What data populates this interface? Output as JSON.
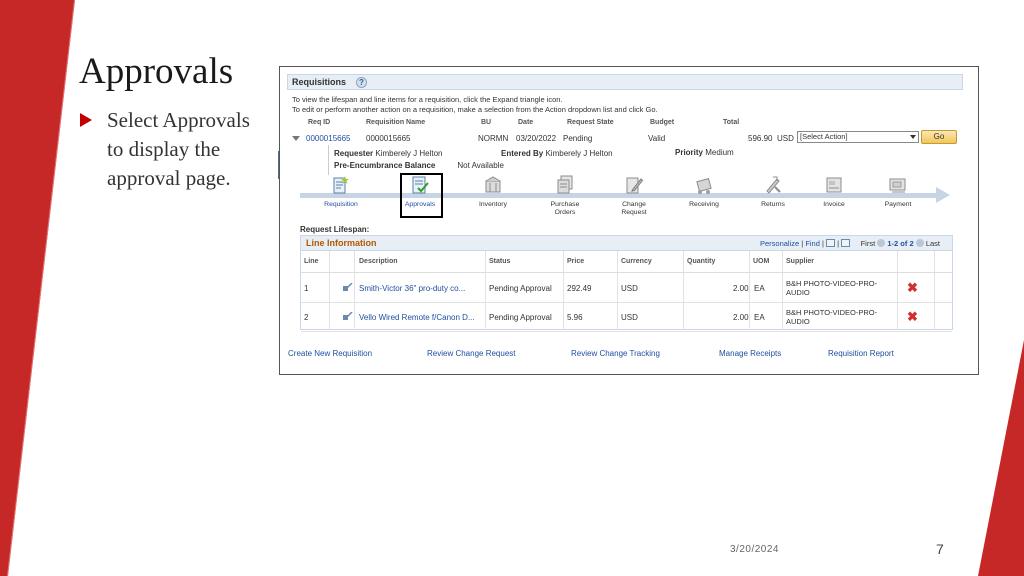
{
  "slide": {
    "title": "Approvals",
    "bullet": "Select Approvals to display the approval page.",
    "date": "3/20/2024",
    "page_number": "7",
    "accent_color": "#c00000"
  },
  "requisitions": {
    "header": "Requisitions",
    "help_icon": "?",
    "instructions": [
      "To view the lifespan and line items for a requisition, click the Expand triangle icon.",
      "To edit or perform another action on a requisition, make a selection from the Action dropdown list and click Go."
    ],
    "columns": [
      "Req ID",
      "Requisition Name",
      "BU",
      "Date",
      "Request State",
      "Budget",
      "Total"
    ],
    "row": {
      "req_id": "0000015665",
      "name": "0000015665",
      "bu": "NORMN",
      "date": "03/20/2022",
      "state": "Pending",
      "budget": "Valid",
      "total": "596.90",
      "currency": "USD",
      "action_placeholder": "[Select Action]",
      "go_label": "Go"
    },
    "details": {
      "requester_label": "Requester",
      "requester": "Kimberely J Helton",
      "entered_by_label": "Entered By",
      "entered_by": "Kimberely J Helton",
      "priority_label": "Priority",
      "priority": "Medium",
      "pre_enc_label": "Pre-Encumbrance Balance",
      "pre_enc": "Not Available"
    },
    "lifespan_steps": [
      {
        "label": "Requisition",
        "icon": "requisition-icon"
      },
      {
        "label": "Approvals",
        "icon": "approvals-icon"
      },
      {
        "label": "Inventory",
        "icon": "inventory-icon"
      },
      {
        "label": "Purchase\nOrders",
        "icon": "purchase-orders-icon"
      },
      {
        "label": "Change\nRequest",
        "icon": "change-request-icon"
      },
      {
        "label": "Receiving",
        "icon": "receiving-icon"
      },
      {
        "label": "Returns",
        "icon": "returns-icon"
      },
      {
        "label": "Invoice",
        "icon": "invoice-icon"
      },
      {
        "label": "Payment",
        "icon": "payment-icon"
      }
    ],
    "lifespan_label": "Request Lifespan:",
    "line_info": {
      "title": "Line Information",
      "personalize": "Personalize",
      "find": "Find",
      "first": "First",
      "range": "1-2 of 2",
      "last": "Last",
      "columns": [
        "Line",
        "Description",
        "Status",
        "Price",
        "Currency",
        "Quantity",
        "UOM",
        "Supplier"
      ],
      "rows": [
        {
          "line": "1",
          "description": "Smith-Victor 36\" pro-duty co...",
          "status": "Pending Approval",
          "price": "292.49",
          "currency": "USD",
          "quantity": "2.00",
          "uom": "EA",
          "supplier": "B&H PHOTO-VIDEO-PRO-AUDIO"
        },
        {
          "line": "2",
          "description": "Vello Wired Remote f/Canon D...",
          "status": "Pending Approval",
          "price": "5.96",
          "currency": "USD",
          "quantity": "2.00",
          "uom": "EA",
          "supplier": "B&H PHOTO-VIDEO-PRO-AUDIO"
        }
      ]
    },
    "footer_links": [
      "Create New Requisition",
      "Review Change Request",
      "Review Change Tracking",
      "Manage Receipts",
      "Requisition Report"
    ]
  }
}
